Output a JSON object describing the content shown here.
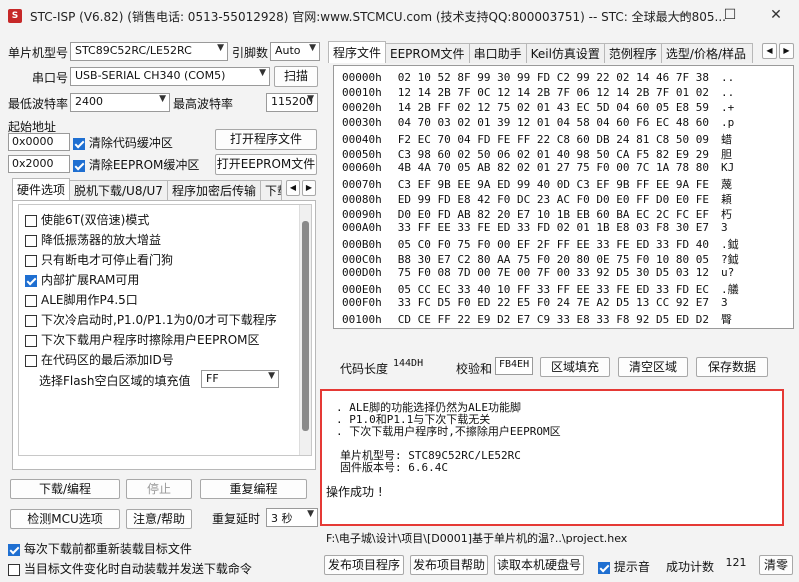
{
  "window": {
    "title": "STC-ISP (V6.82) (销售电话: 0513-55012928) 官网:www.STCMCU.com  (技术支持QQ:800003751)  -- STC: 全球最大的805...",
    "minimize": "—",
    "maximize": "☐",
    "close": "✕"
  },
  "left": {
    "mcu_label": "单片机型号",
    "mcu_value": "STC89C52RC/LE52RC",
    "pins_label": "引脚数",
    "pins_value": "Auto",
    "port_label": "串口号",
    "port_value": "USB-SERIAL CH340 (COM5)",
    "scan_button": "扫描",
    "min_baud_label": "最低波特率",
    "min_baud_value": "2400",
    "max_baud_label": "最高波特率",
    "max_baud_value": "115200",
    "start_addr_label": "起始地址",
    "addr1": "0x0000",
    "clear_code_label": "清除代码缓冲区",
    "open_prog_button": "打开程序文件",
    "addr2": "0x2000",
    "clear_eeprom_label": "清除EEPROM缓冲区",
    "open_eeprom_button": "打开EEPROM文件",
    "tabs": [
      "硬件选项",
      "脱机下载/U8/U7",
      "程序加密后传输",
      "下载"
    ],
    "options": [
      {
        "label": "使能6T(双倍速)模式",
        "checked": false
      },
      {
        "label": "降低振荡器的放大增益",
        "checked": false
      },
      {
        "label": "只有断电才可停止看门狗",
        "checked": false
      },
      {
        "label": "内部扩展RAM可用",
        "checked": true
      },
      {
        "label": "ALE脚用作P4.5口",
        "checked": false
      },
      {
        "label": "下次冷启动时,P1.0/P1.1为0/0才可下载程序",
        "checked": false
      },
      {
        "label": "下次下载用户程序时擦除用户EEPROM区",
        "checked": false
      },
      {
        "label": "在代码区的最后添加ID号",
        "checked": false
      }
    ],
    "fill_label": "选择Flash空白区域的填充值",
    "fill_value": "FF",
    "download_button": "下载/编程",
    "stop_button": "停止",
    "reprogram_button": "重复编程",
    "detect_button": "检测MCU选项",
    "help_button": "注意/帮助",
    "delay_label": "重复延时",
    "delay_value": "3 秒",
    "reload_label": "每次下载前都重新装载目标文件",
    "reload_checked": true,
    "auto_label": "当目标文件变化时自动装载并发送下载命令",
    "auto_checked": false
  },
  "right": {
    "tabs": [
      "程序文件",
      "EEPROM文件",
      "串口助手",
      "Keil仿真设置",
      "范例程序",
      "选型/价格/样品"
    ],
    "hex_rows": [
      {
        "addr": "00000h",
        "bytes": "02 10 52 8F 99 30 99 FD C2 99 22 02 14 46 7F 38",
        "ascii": ".."
      },
      {
        "addr": "00010h",
        "bytes": "12 14 2B 7F 0C 12 14 2B 7F 06 12 14 2B 7F 01 02",
        "ascii": ".."
      },
      {
        "addr": "00020h",
        "bytes": "14 2B FF 02 12 75 02 01 43 EC 5D 04 60 05 E8 59",
        "ascii": ".+"
      },
      {
        "addr": "00030h",
        "bytes": "04 70 03 02 01 39 12 01 04 58 04 60 F6 EC 48 60",
        "ascii": ".p"
      },
      {
        "addr": "00040h",
        "bytes": "F2 EC 70 04 FD FE FF 22 C8 60 DB 24 81 C8 50 09",
        "ascii": "蜡"
      },
      {
        "addr": "00050h",
        "bytes": "C3 98 60 02 50 06 02 01 40 98 50 CA F5 82 E9 29",
        "ascii": "胆"
      },
      {
        "addr": "00060h",
        "bytes": "4B 4A 70 05 AB 82 02 01 27 75 F0 00 7C 1A 78 80",
        "ascii": "KJ"
      },
      {
        "addr": "00070h",
        "bytes": "C3 EF 9B EE 9A ED 99 40 0D C3 EF 9B FF EE 9A FE",
        "ascii": "蔑"
      },
      {
        "addr": "00080h",
        "bytes": "ED 99 FD E8 42 F0 DC 23 AC F0 D0 E0 FF D0 E0 FE",
        "ascii": "頛"
      },
      {
        "addr": "00090h",
        "bytes": "D0 E0 FD AB 82 20 E7 10 1B EB 60 BA EC 2C FC EF",
        "ascii": "朽"
      },
      {
        "addr": "000A0h",
        "bytes": "33 FF EE 33 FE ED 33 FD 02 01 1B E8 03 F8 30 E7",
        "ascii": "3"
      },
      {
        "addr": "000B0h",
        "bytes": "05 C0 F0 75 F0 00 EF 2F FF EE 33 FE ED 33 FD 40",
        "ascii": ".鉞"
      },
      {
        "addr": "000C0h",
        "bytes": "B8 30 E7 C2 80 AA 75 F0 20 80 0E 75 F0 10 80 05",
        "ascii": "?鉞"
      },
      {
        "addr": "000D0h",
        "bytes": "75 F0 08 7D 00 7E 00 7F 00 33 92 D5 30 D5 03 12",
        "ascii": "u?"
      },
      {
        "addr": "000E0h",
        "bytes": "05 CC EC 33 40 10 FF 33 FF EE 33 FE ED 33 FD EC",
        "ascii": ".艤"
      },
      {
        "addr": "000F0h",
        "bytes": "33 FC D5 F0 ED 22 E5 F0 24 7E A2 D5 13 CC 92 E7",
        "ascii": "3"
      },
      {
        "addr": "00100h",
        "bytes": "CD CE FF 22 E9 D2 E7 C9 33 E8 33 F8 92 D5 ED D2",
        "ascii": "臀"
      }
    ],
    "code_len_label": "代码长度",
    "code_len_value": "144DH",
    "checksum_label": "校验和",
    "checksum_value": "FB4EH",
    "fill_area_button": "区域填充",
    "clear_area_button": "清空区域",
    "save_data_button": "保存数据",
    "log_lines": [
      ". ALE脚的功能选择仍然为ALE功能脚",
      ". P1.0和P1.1与下次下载无关",
      ". 下次下载用户程序时,不擦除用户EEPROM区",
      "",
      "单片机型号: STC89C52RC/LE52RC",
      "固件版本号: 6.6.4C",
      "",
      "操作成功 !"
    ],
    "path": "F:\\电子城\\设计\\项目\\[D0001]基于单片机的温?..\\project.hex",
    "publish_prog_button": "发布项目程序",
    "publish_help_button": "发布项目帮助",
    "read_disk_button": "读取本机硬盘号",
    "sound_label": "提示音",
    "sound_checked": true,
    "success_count_label": "成功计数",
    "success_count_value": "121",
    "clear_button": "清零"
  }
}
